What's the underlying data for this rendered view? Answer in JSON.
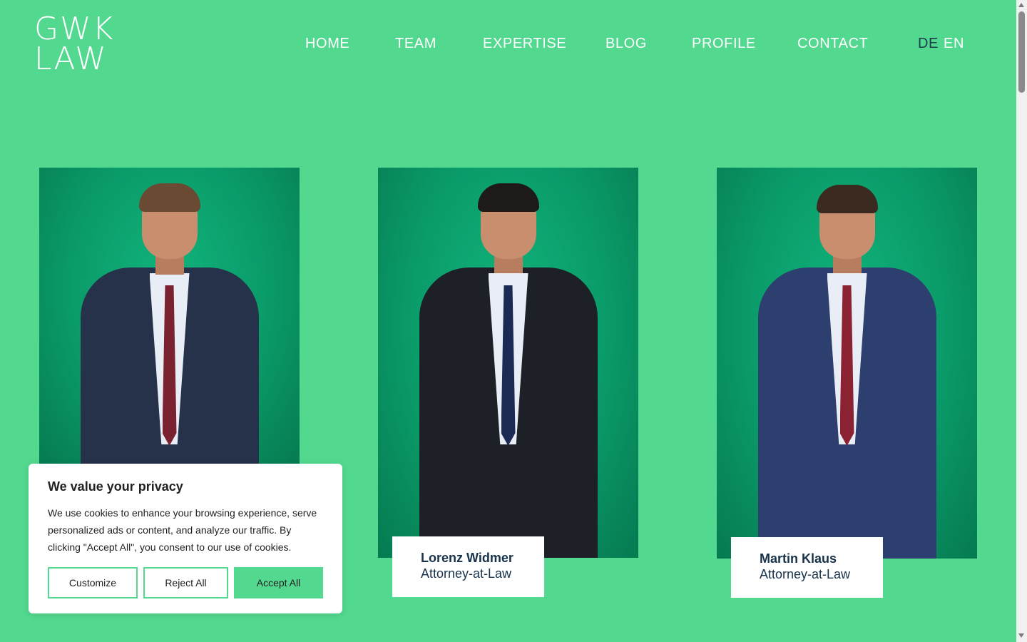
{
  "logo": {
    "line1": "GWK",
    "line2": "LAW"
  },
  "nav": {
    "items": [
      {
        "label": "HOME"
      },
      {
        "label": "TEAM"
      },
      {
        "label": "EXPERTISE"
      },
      {
        "label": "BLOG"
      },
      {
        "label": "PROFILE"
      },
      {
        "label": "CONTACT"
      }
    ],
    "languages": [
      {
        "label": "DE",
        "active": true
      },
      {
        "label": "EN",
        "active": false
      }
    ]
  },
  "team": [
    {
      "name": "",
      "role": "",
      "photo": "portrait of man in navy suit with red tie"
    },
    {
      "name": "Lorenz Widmer",
      "role": "Attorney-at-Law",
      "photo": "portrait of man in dark suit with navy tie"
    },
    {
      "name": "Martin Klaus",
      "role": "Attorney-at-Law",
      "photo": "portrait of man in blue suit with red tie"
    }
  ],
  "cookie_banner": {
    "title": "We value your privacy",
    "message": "We use cookies to enhance your browsing experience, serve personalized ads or content, and analyze our traffic. By clicking \"Accept All\", you consent to our use of cookies.",
    "customize_label": "Customize",
    "reject_label": "Reject All",
    "accept_label": "Accept All"
  },
  "colors": {
    "background": "#52d98f",
    "photo_backdrop": "#0a9a68",
    "name_text": "#17324a",
    "active_language": "#1f3b4d",
    "accept_button": "#52d98f"
  }
}
